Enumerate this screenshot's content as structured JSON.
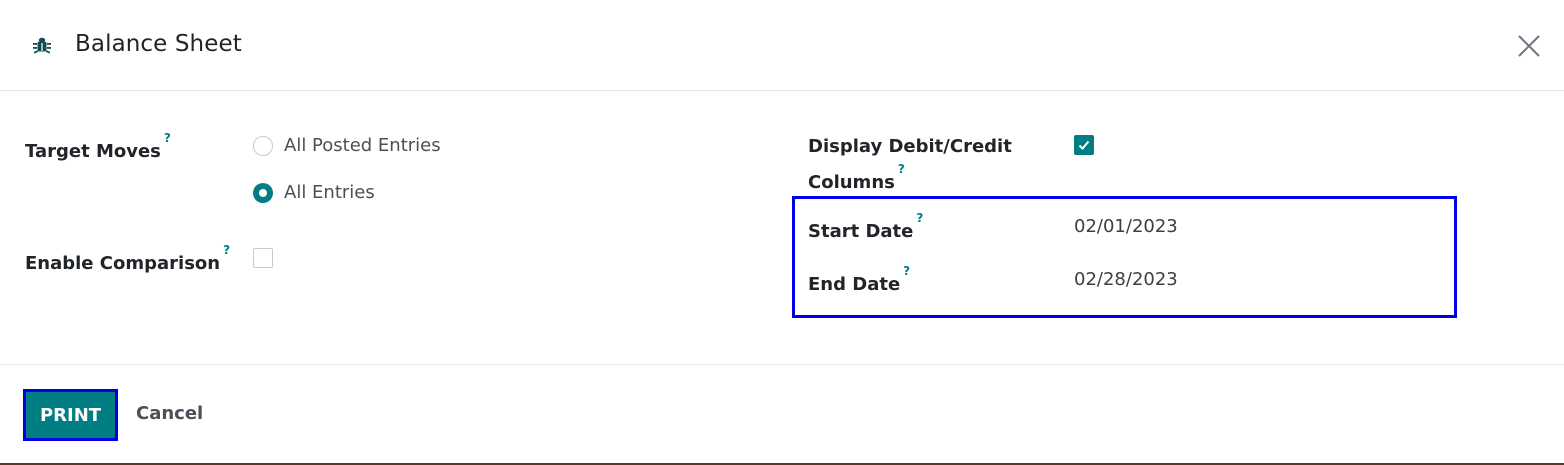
{
  "dialog": {
    "title": "Balance Sheet",
    "icon": "bug-icon",
    "close_icon": "close-icon"
  },
  "form": {
    "help_marker": "?",
    "target_moves": {
      "label": "Target Moves",
      "options": [
        {
          "label": "All Posted Entries",
          "checked": false
        },
        {
          "label": "All Entries",
          "checked": true
        }
      ]
    },
    "enable_comparison": {
      "label": "Enable Comparison",
      "checked": false
    },
    "display_debit_credit": {
      "label_line1": "Display Debit/Credit",
      "label_line2": "Columns",
      "checked": true
    },
    "start_date": {
      "label": "Start Date",
      "value": "02/01/2023"
    },
    "end_date": {
      "label": "End Date",
      "value": "02/28/2023"
    }
  },
  "footer": {
    "print_label": "PRINT",
    "cancel_label": "Cancel"
  },
  "colors": {
    "accent": "#017e84",
    "highlight": "#0000e6",
    "text": "#212529"
  }
}
